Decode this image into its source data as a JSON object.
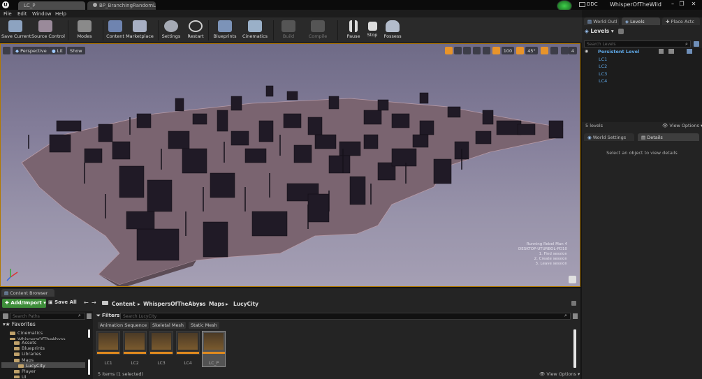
{
  "titlebar": {
    "tabs": [
      "LC_P",
      "BP_BranchingRandomLevel"
    ],
    "ddc_label": "DDC",
    "project_name": "WhisperOfTheWild"
  },
  "menu": [
    "File",
    "Edit",
    "Window",
    "Help"
  ],
  "toolbar": {
    "buttons": [
      "Save Current",
      "Source Control",
      "Modes",
      "Content",
      "Marketplace",
      "Settings",
      "Restart",
      "Blueprints",
      "Cinematics",
      "Build",
      "Compile",
      "Pause",
      "Stop",
      "Possess"
    ]
  },
  "viewport": {
    "perspective_label": "Perspective",
    "lit_label": "Lit",
    "show_label": "Show",
    "grid_snap_value": "100",
    "rotation_snap_value": "45°",
    "camera_speed_value": "4",
    "debug_messages": [
      "Running Rebel Man 4",
      "DESKTOP-UTURBOL-PD10",
      "1. Find session",
      "2. Create session",
      "3. Leave session"
    ]
  },
  "right_panel": {
    "tabs": [
      "World Outl",
      "Levels",
      "Place Actc"
    ],
    "levels_menu": "Levels",
    "search_placeholder": "Search Levels",
    "persistent_level": "Persistent Level",
    "levels": [
      "LC1",
      "LC2",
      "LC3",
      "LC4"
    ],
    "levels_count": "5 levels",
    "view_options": "View Options",
    "lower_tabs": [
      "World Settings",
      "Details"
    ],
    "details_hint": "Select an object to view details"
  },
  "content_browser": {
    "tab_label": "Content Browser",
    "add_import": "Add/Import",
    "save_all": "Save All",
    "path": [
      "Content",
      "WhispersOfTheAbyss",
      "Maps",
      "LucyCity"
    ],
    "search_paths_placeholder": "Search Paths",
    "filters_label": "Filters",
    "search_placeholder": "Search LucyCity",
    "filter_tags": [
      "Animation Sequence",
      "Skeletal Mesh",
      "Static Mesh"
    ],
    "favorites_label": "Favorites",
    "favorites": [
      "Cinematics",
      "WhispersOfTheAbyss"
    ],
    "folders": [
      "Assets",
      "Blueprints",
      "Libraries",
      "Maps",
      "LucyCity",
      "Player",
      "UI"
    ],
    "assets": [
      "LC1",
      "LC2",
      "LC3",
      "LC4",
      "LC_P"
    ],
    "status": "5 items (1 selected)",
    "view_options": "View Options"
  }
}
